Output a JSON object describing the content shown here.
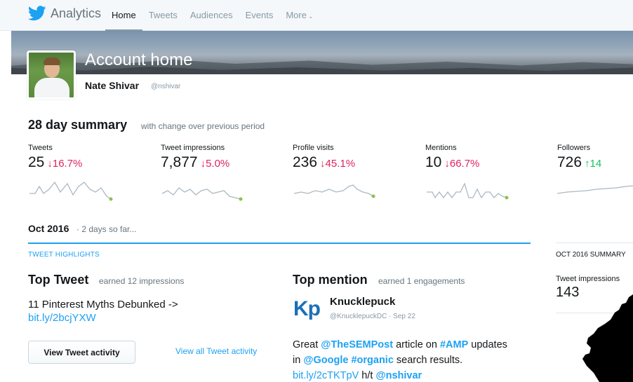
{
  "nav": {
    "brand": "Analytics",
    "items": [
      {
        "label": "Home",
        "active": true
      },
      {
        "label": "Tweets",
        "active": false
      },
      {
        "label": "Audiences",
        "active": false
      },
      {
        "label": "Events",
        "active": false
      },
      {
        "label": "More",
        "active": false
      }
    ]
  },
  "header": {
    "title": "Account home",
    "name": "Nate Shivar",
    "handle": "@nshivar"
  },
  "summary": {
    "heading": "28 day summary",
    "subheading": "with change over previous period",
    "stats": [
      {
        "label": "Tweets",
        "value": "25",
        "change": "↓16.7%",
        "direction": "down"
      },
      {
        "label": "Tweet impressions",
        "value": "7,877",
        "change": "↓5.0%",
        "direction": "down"
      },
      {
        "label": "Profile visits",
        "value": "236",
        "change": "↓45.1%",
        "direction": "down"
      },
      {
        "label": "Mentions",
        "value": "10",
        "change": "↓66.7%",
        "direction": "down"
      },
      {
        "label": "Followers",
        "value": "726",
        "change": "↑14",
        "direction": "up"
      }
    ]
  },
  "month": {
    "heading": "Oct 2016",
    "subheading": "· 2 days so far..."
  },
  "highlights": {
    "label": "TWEET HIGHLIGHTS",
    "top_tweet": {
      "heading": "Top Tweet",
      "subheading": "earned 12 impressions",
      "text": "11 Pinterest Myths Debunked ->",
      "link": "bit.ly/2bcjYXW",
      "button": "View Tweet activity",
      "view_all": "View all Tweet activity"
    },
    "top_mention": {
      "heading": "Top mention",
      "subheading": "earned 1 engagements",
      "logo_text": "Kp",
      "name": "Knucklepuck",
      "handle": "@KnucklepuckDC · Sep 22",
      "text_parts": {
        "t1": "Great ",
        "mention1": "@TheSEMPost",
        "t2": " article on ",
        "hashtag1": "#AMP",
        "t3": " updates in ",
        "mention2": "@Google",
        "t4": " ",
        "hashtag2": "#organic",
        "t5": " search results. ",
        "link": "bit.ly/2cTKTpV",
        "t6": " h/t ",
        "mention3": "@nshivar"
      }
    }
  },
  "month_summary": {
    "label": "OCT 2016 SUMMARY",
    "impressions_label": "Tweet impressions",
    "impressions_value": "143"
  },
  "colors": {
    "accent": "#1da1f2",
    "down": "#e0245e",
    "up": "#17bf63",
    "sparkline": "#aab8c2",
    "sparkline_end": "#8bc34a"
  },
  "icons": [
    "twitter-bird-icon",
    "chevron-down-icon"
  ]
}
